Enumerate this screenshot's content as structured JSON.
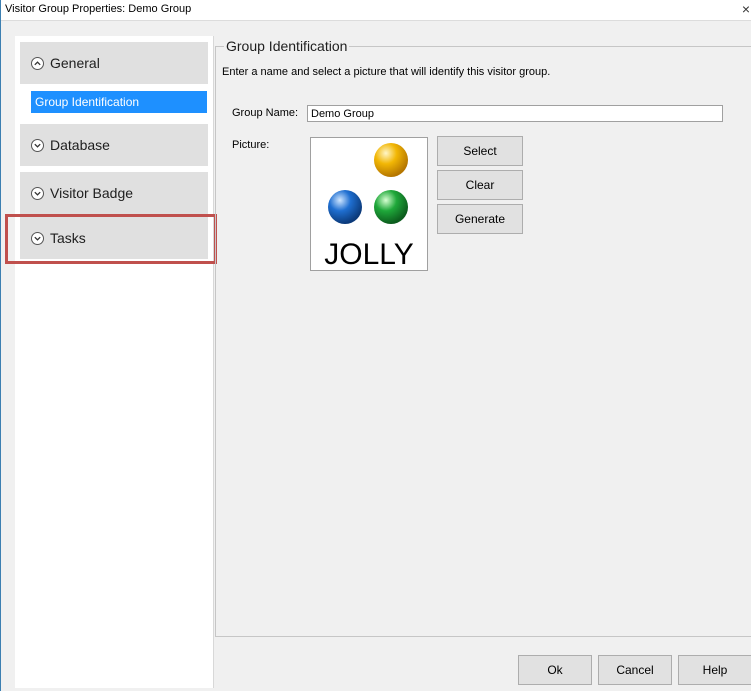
{
  "window": {
    "title": "Visitor Group Properties: Demo Group",
    "close_glyph": "×"
  },
  "sidebar": {
    "sections": [
      {
        "label": "General",
        "state": "expanded",
        "icon": "chevron-up-icon"
      },
      {
        "label": "Database",
        "state": "collapsed",
        "icon": "chevron-down-icon"
      },
      {
        "label": "Visitor Badge",
        "state": "collapsed",
        "icon": "chevron-down-icon"
      },
      {
        "label": "Tasks",
        "state": "collapsed",
        "icon": "chevron-down-icon"
      }
    ],
    "selected_item": "Group Identification"
  },
  "main": {
    "group_title": "Group Identification",
    "description": "Enter a name and select a picture that will identify this visitor group.",
    "group_name_label": "Group Name:",
    "group_name_value": "Demo Group",
    "picture_label": "Picture:",
    "picture_text": "JOLLY",
    "buttons": {
      "select": "Select",
      "clear": "Clear",
      "generate": "Generate"
    }
  },
  "footer": {
    "ok": "Ok",
    "cancel": "Cancel",
    "help": "Help"
  },
  "colors": {
    "selection": "#1e90ff",
    "highlight_box": "#c0504d",
    "sphere_yellow": "#f2b705",
    "sphere_blue": "#1f6fd1",
    "sphere_green": "#1fa83a"
  }
}
